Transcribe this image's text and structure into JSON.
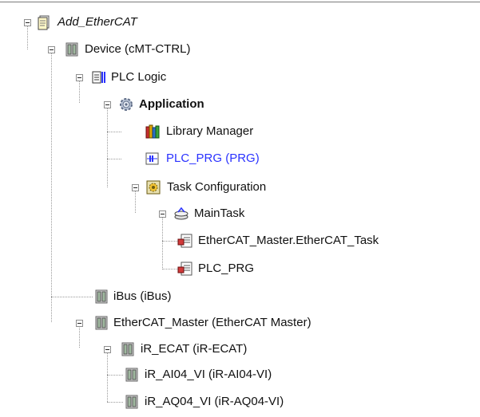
{
  "tree": {
    "root": "Add_EtherCAT",
    "device": "Device (cMT-CTRL)",
    "plc_logic": "PLC Logic",
    "application": "Application",
    "library_manager": "Library Manager",
    "plc_prg": "PLC_PRG (PRG)",
    "task_configuration": "Task Configuration",
    "main_task": "MainTask",
    "ethercat_task": "EtherCAT_Master.EtherCAT_Task",
    "plc_prg_call": "PLC_PRG",
    "ibus": "iBus (iBus)",
    "ethercat_master": "EtherCAT_Master (EtherCAT Master)",
    "ir_ecat": "iR_ECAT (iR-ECAT)",
    "ir_ai04": "iR_AI04_VI (iR-AI04-VI)",
    "ir_aq04": "iR_AQ04_VI (iR-AQ04-VI)"
  },
  "icons": {
    "root": "project-file-icon",
    "device": "device-icon",
    "plc_logic": "plc-logic-icon",
    "application": "application-gear-icon",
    "library_manager": "library-books-icon",
    "plc_prg": "program-pou-icon",
    "task_configuration": "task-configuration-icon",
    "main_task": "task-icon",
    "ethercat_task": "program-call-icon",
    "plc_prg_call": "program-call-icon",
    "ibus": "device-icon",
    "ethercat_master": "device-icon",
    "ir_ecat": "device-icon",
    "ir_ai04": "device-icon",
    "ir_aq04": "device-icon"
  },
  "colors": {
    "link": "#2a32ff",
    "text": "#111111",
    "connector": "#9a9a9a"
  }
}
